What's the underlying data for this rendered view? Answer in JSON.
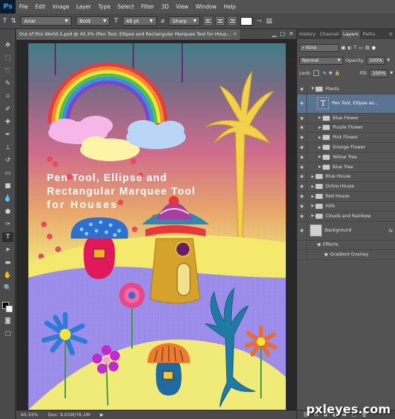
{
  "app": {
    "logo": "Ps"
  },
  "menu": [
    "File",
    "Edit",
    "Image",
    "Layer",
    "Type",
    "Select",
    "Filter",
    "3D",
    "View",
    "Window",
    "Help"
  ],
  "options": {
    "tool_icon": "T",
    "font_family": "Arial",
    "font_style": "Bold",
    "size_icon": "T",
    "font_size": "48 pt",
    "aa_icon": "a",
    "antialias": "Sharp",
    "text_color": "#ffffff"
  },
  "document": {
    "tab_title": "Out of this World 2.psd @ 40.3% (Pen Tool, Ellipse and  Rectangular Marquee Tool for Hous...",
    "canvas_text": [
      "Pen Tool, Ellipse and",
      "Rectangular Marquee Tool",
      "for Houses"
    ],
    "zoom": "40.33%",
    "doc_size": "Doc: 9.01M/76.1M"
  },
  "panel": {
    "tabs": [
      "History",
      "Channel",
      "Layers",
      "Paths"
    ],
    "active_tab": "Layers",
    "filter": "Kind",
    "blend_mode": "Normal",
    "opacity_label": "Opacity:",
    "opacity": "100%",
    "lock_label": "Lock:",
    "fill_label": "Fill:",
    "fill": "100%",
    "layers": [
      {
        "name": "Plants",
        "type": "group-open",
        "indent": 0
      },
      {
        "name": "Pen Tool, Ellipse an...",
        "type": "text",
        "indent": 1,
        "selected": true
      },
      {
        "name": "Blue Flower",
        "type": "group",
        "indent": 1
      },
      {
        "name": "Purple Flower",
        "type": "group",
        "indent": 1
      },
      {
        "name": "Pink Flower",
        "type": "group",
        "indent": 1
      },
      {
        "name": "Orange Flower",
        "type": "group",
        "indent": 1
      },
      {
        "name": "Yellow Tree",
        "type": "group",
        "indent": 1
      },
      {
        "name": "Blue Tree",
        "type": "group",
        "indent": 1
      },
      {
        "name": "Blue House",
        "type": "group",
        "indent": 0
      },
      {
        "name": "Ochre House",
        "type": "group",
        "indent": 0
      },
      {
        "name": "Red House",
        "type": "group",
        "indent": 0
      },
      {
        "name": "Hills",
        "type": "group",
        "indent": 0
      },
      {
        "name": "Clouds and Rainbow",
        "type": "group",
        "indent": 0
      },
      {
        "name": "Background",
        "type": "background",
        "indent": 0,
        "fx": "fx"
      },
      {
        "name": "Effects",
        "type": "effects",
        "indent": 1
      },
      {
        "name": "Gradient Overlay",
        "type": "effect",
        "indent": 2
      }
    ]
  },
  "watermark": "pxleyes.com",
  "colors": {
    "accent_selected": "#5b7392",
    "ui_dark": "#3a3a3a",
    "ui_mid": "#535353"
  }
}
